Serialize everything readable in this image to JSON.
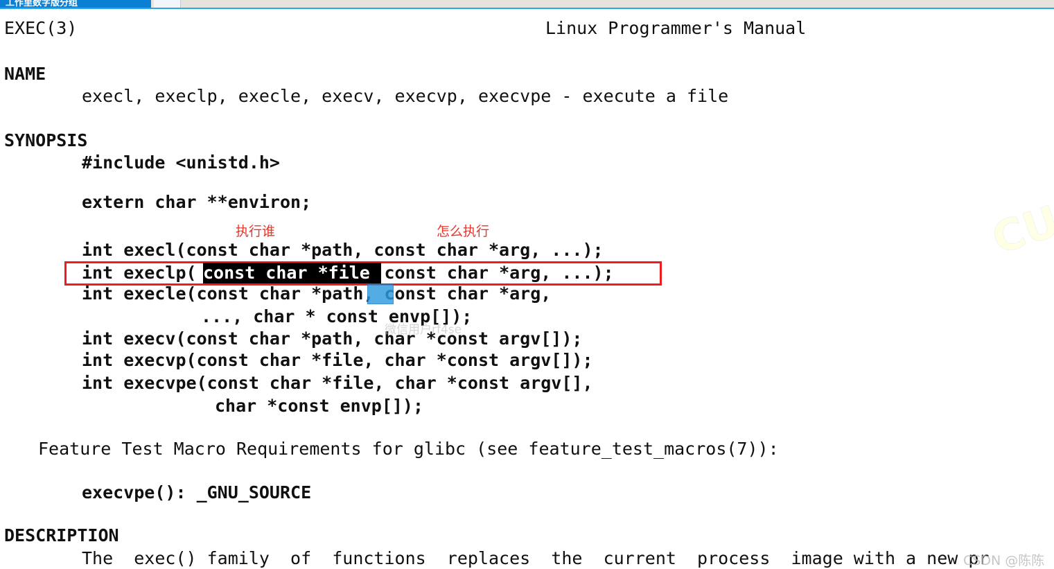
{
  "window": {
    "titlebar_text": "工作里数字版分组",
    "active_tab_color": "#0b7fd4",
    "accent_underline_color": "#2aa8e0"
  },
  "manpage": {
    "header_left": "EXEC(3)",
    "header_right": "Linux Programmer's Manual",
    "sections": {
      "name_heading": "NAME",
      "name_body": "execl, execlp, execle, execv, execvp, execvpe - execute a file",
      "synopsis_heading": "SYNOPSIS",
      "synopsis_include": "#include <unistd.h>",
      "synopsis_extern": "extern char **environ;",
      "description_heading": "DESCRIPTION",
      "description_body": "The  exec() family  of  functions  replaces  the  current  process  image with a new pr"
    },
    "prototypes": {
      "execl": "int execl(const char *path, const char *arg, ...);",
      "execlp_prefix": "int execlp(",
      "execlp_selected": "const char *file",
      "execlp_suffix": ", const char *arg, ...);",
      "execle": "int execle(const char *path, const char *arg,",
      "execle_cont": "..., char * const envp[]);",
      "execv": "int execv(const char *path, char *const argv[]);",
      "execvp": "int execvp(const char *file, char *const argv[]);",
      "execvpe": "int execvpe(const char *file, char *const argv[],",
      "execvpe_cont": "char *const envp[]);"
    },
    "feature_test": {
      "line": "Feature Test Macro Requirements for glibc (see feature_test_macros(7)):",
      "entry": "execvpe(): _GNU_SOURCE"
    }
  },
  "annotations": {
    "color": "#e8342a",
    "who_label": "执行谁",
    "how_label": "怎么执行",
    "highlight_box_color": "#ee1c21",
    "selection_black_bg": "#000000",
    "selection_blue_bg": "#2f9be0"
  },
  "watermarks": {
    "wechat": "微信用户rf4se",
    "csdn": "CSDN @陈陈",
    "corner": "CU"
  }
}
